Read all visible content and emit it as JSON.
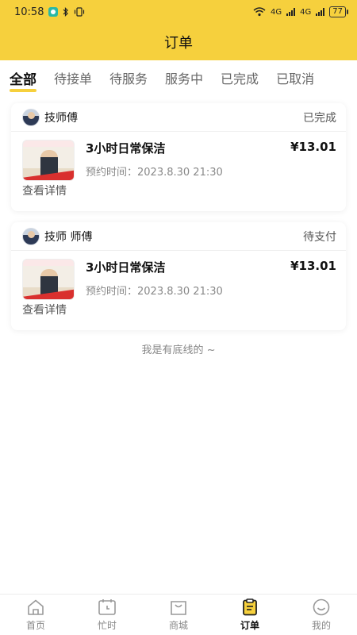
{
  "status_bar": {
    "time": "10:58",
    "network_left": "4G",
    "network_right": "4G",
    "battery": "77"
  },
  "header": {
    "title": "订单"
  },
  "tabs": [
    {
      "label": "全部",
      "active": true
    },
    {
      "label": "待接单",
      "active": false
    },
    {
      "label": "待服务",
      "active": false
    },
    {
      "label": "服务中",
      "active": false
    },
    {
      "label": "已完成",
      "active": false
    },
    {
      "label": "已取消",
      "active": false
    }
  ],
  "orders": [
    {
      "technician": "技师傅",
      "status": "已完成",
      "service": "3小时日常保洁",
      "price": "¥13.01",
      "appointment": "预约时间：2023.8.30 21:30",
      "detail_label": "查看详情"
    },
    {
      "technician": "技师 师傅",
      "status": "待支付",
      "service": "3小时日常保洁",
      "price": "¥13.01",
      "appointment": "预约时间：2023.8.30 21:30",
      "detail_label": "查看详情"
    }
  ],
  "bottom_text": "我是有底线的 ~",
  "tabbar": [
    {
      "label": "首页",
      "icon": "home-icon"
    },
    {
      "label": "忙时",
      "icon": "calendar-icon"
    },
    {
      "label": "商城",
      "icon": "shop-icon"
    },
    {
      "label": "订单",
      "icon": "order-clipboard-icon",
      "active": true
    },
    {
      "label": "我的",
      "icon": "smile-profile-icon"
    }
  ],
  "colors": {
    "accent": "#f6d03d"
  }
}
